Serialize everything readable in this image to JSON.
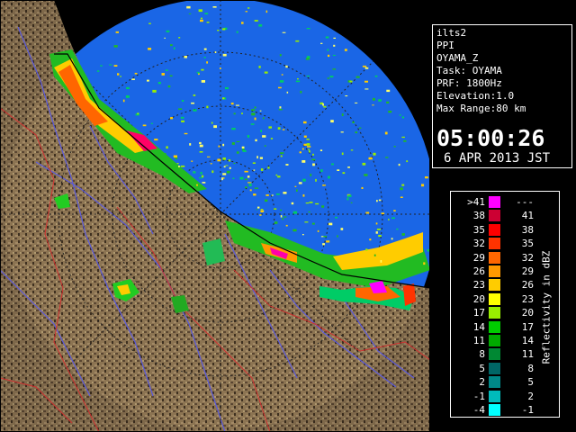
{
  "header": {
    "lines": [
      "ilts2",
      "PPI",
      "OYAMA_Z",
      "Task: OYAMA",
      "PRF: 1800Hz",
      "Elevation:1.0",
      "Max Range:80 km"
    ],
    "time": "05:00:26",
    "date": "6 APR 2013 JST"
  },
  "legend": {
    "unit_label": "Reflectivity in dBZ",
    "rows": [
      {
        "low": ">41",
        "high": "---",
        "color": "#ff00ff"
      },
      {
        "low": "38",
        "high": "41",
        "color": "#cc0033"
      },
      {
        "low": "35",
        "high": "38",
        "color": "#ff0000"
      },
      {
        "low": "32",
        "high": "35",
        "color": "#ff3300"
      },
      {
        "low": "29",
        "high": "32",
        "color": "#ff6600"
      },
      {
        "low": "26",
        "high": "29",
        "color": "#ff9900"
      },
      {
        "low": "23",
        "high": "26",
        "color": "#ffcc00"
      },
      {
        "low": "20",
        "high": "23",
        "color": "#ffff00"
      },
      {
        "low": "17",
        "high": "20",
        "color": "#99ee00"
      },
      {
        "low": "14",
        "high": "17",
        "color": "#00cc00"
      },
      {
        "low": "11",
        "high": "14",
        "color": "#00aa00"
      },
      {
        "low": "8",
        "high": "11",
        "color": "#008833"
      },
      {
        "low": "5",
        "high": "8",
        "color": "#006666"
      },
      {
        "low": "2",
        "high": "5",
        "color": "#008888"
      },
      {
        "low": "-1",
        "high": "2",
        "color": "#00bbbb"
      },
      {
        "low": "-4",
        "high": "-1",
        "color": "#00ffff"
      }
    ]
  },
  "colors": {
    "sea": "#1a66e6",
    "land": "#8a7250",
    "land_dark": "#4a3a28",
    "river": "#5555dd",
    "border": "#cc3333"
  }
}
